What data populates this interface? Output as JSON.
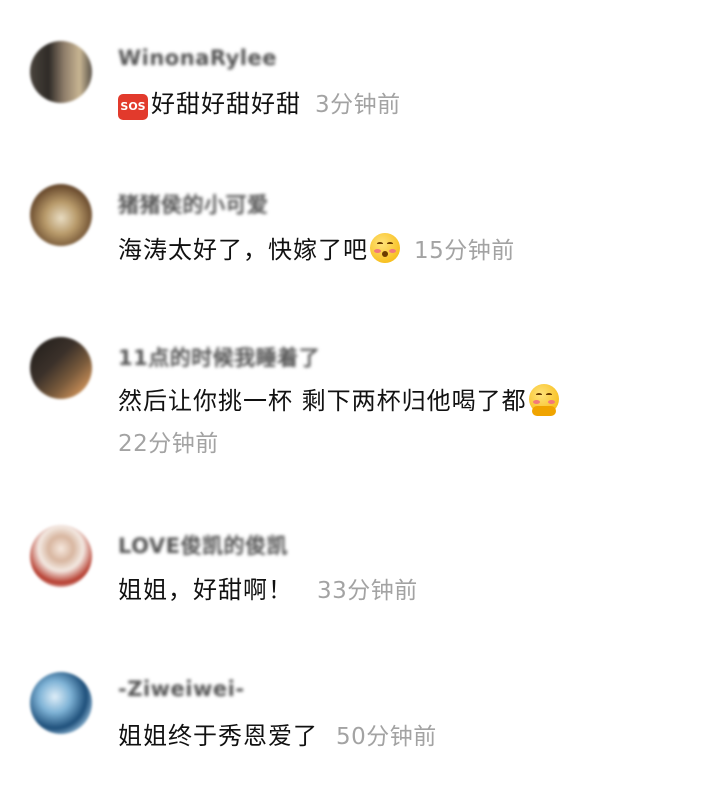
{
  "comments": [
    {
      "username": "WinonaRylee",
      "prefix_icon": "sos-icon",
      "text": "好甜好甜好甜",
      "time": "3分钟前",
      "avatar_colors": [
        "#3a3632",
        "#8d7e6c",
        "#c9b58f"
      ]
    },
    {
      "username": "猪猪侯的小可爱",
      "text": "海涛太好了，快嫁了吧",
      "suffix_icon": "blushing-face-emoji",
      "time": "15分钟前",
      "avatar_colors": [
        "#6a4b2e",
        "#b89a6a",
        "#e8dcc2"
      ]
    },
    {
      "username": "11点的时候我睡着了",
      "text": "然后让你挑一杯 剩下两杯归他喝了都",
      "suffix_icon": "blushing-face-emoji",
      "time": "22分钟前",
      "avatar_colors": [
        "#2a2622",
        "#7a5b3c",
        "#c28a55"
      ]
    },
    {
      "username": "LOVE俊凯的俊凯",
      "text": "姐姐，好甜啊！",
      "time": "33分钟前",
      "avatar_colors": [
        "#f3e9e2",
        "#d8b6a0",
        "#b53a2c"
      ]
    },
    {
      "username": "-Ziweiwei-",
      "text": "姐姐终于秀恩爱了",
      "time": "50分钟前",
      "avatar_colors": [
        "#1e4f7a",
        "#7fb3d6",
        "#dfeef8"
      ]
    }
  ]
}
